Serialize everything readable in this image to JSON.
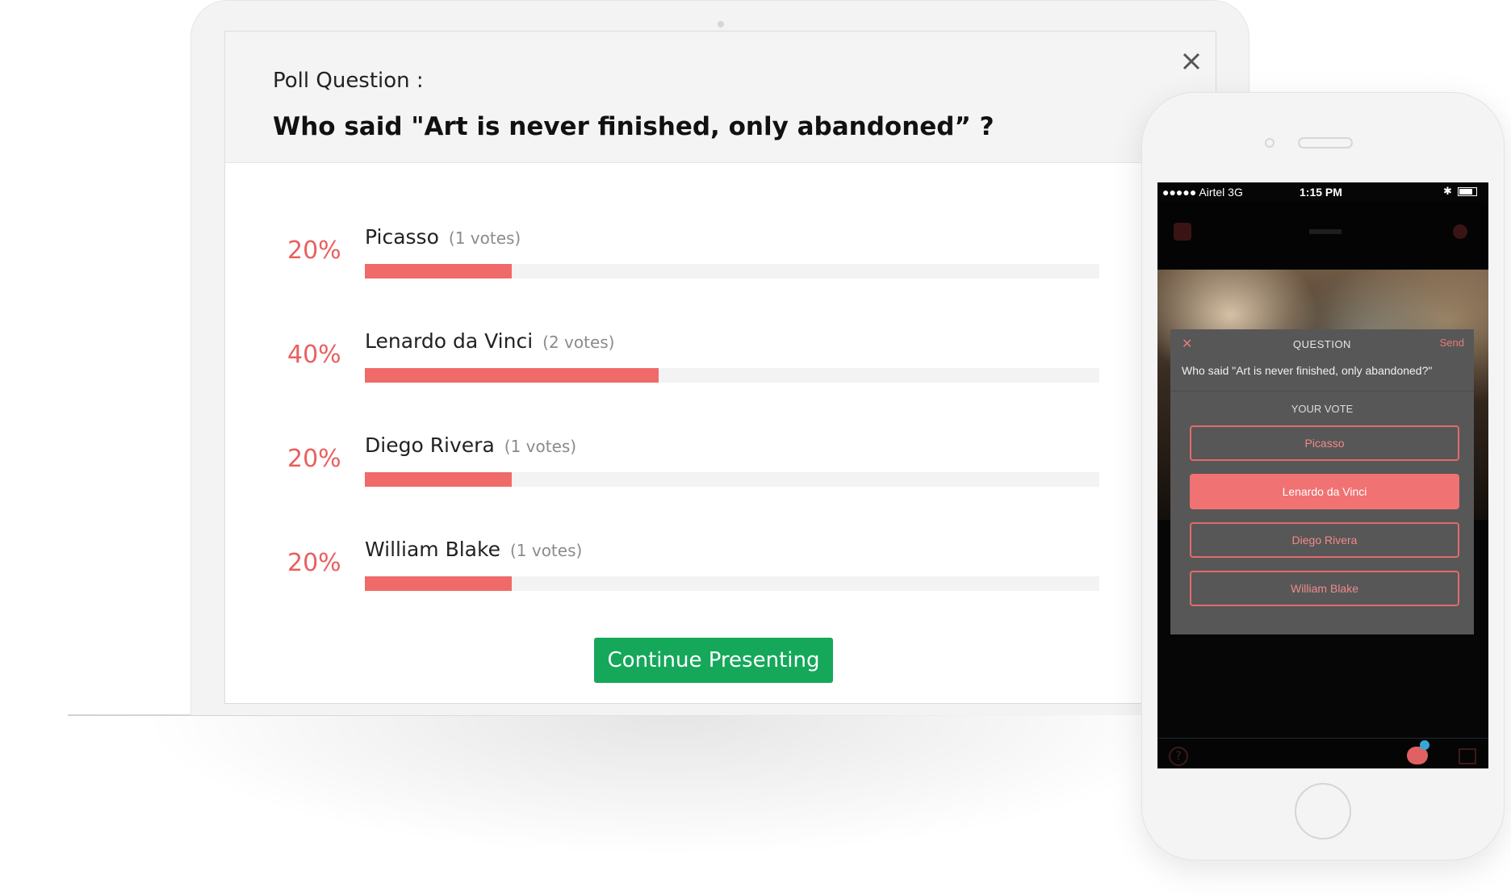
{
  "laptop": {
    "poll_label": "Poll Question :",
    "question": "Who said \"Art is never finished, only abandoned” ?",
    "close_icon": "close-icon",
    "results": [
      {
        "percent": "20%",
        "name": "Picasso",
        "votes": "(1 votes)",
        "share": 0.2
      },
      {
        "percent": "40%",
        "name": "Lenardo da Vinci",
        "votes": "(2 votes)",
        "share": 0.4
      },
      {
        "percent": "20%",
        "name": "Diego Rivera",
        "votes": "(1 votes)",
        "share": 0.2
      },
      {
        "percent": "20%",
        "name": "William Blake",
        "votes": "(1 votes)",
        "share": 0.2
      }
    ],
    "continue_label": "Continue Presenting"
  },
  "phone": {
    "status": {
      "carrier": "●●●●● Airtel  3G",
      "time": "1:15 PM"
    },
    "card": {
      "heading": "QUESTION",
      "send_label": "Send",
      "question": "Who said \"Art is never finished, only abandoned?\"",
      "your_vote_label": "YOUR VOTE",
      "options": [
        "Picasso",
        "Lenardo da Vinci",
        "Diego Rivera",
        "William Blake"
      ],
      "selected_option": "Lenardo da Vinci"
    },
    "bottom_bar_icons": [
      "help-icon",
      "poll-icon",
      "pages-icon"
    ]
  },
  "colors": {
    "accent_red": "#f06a6a",
    "percent_red": "#ea5f5f",
    "continue_green": "#15a85a",
    "badge_blue": "#37a7d8"
  }
}
